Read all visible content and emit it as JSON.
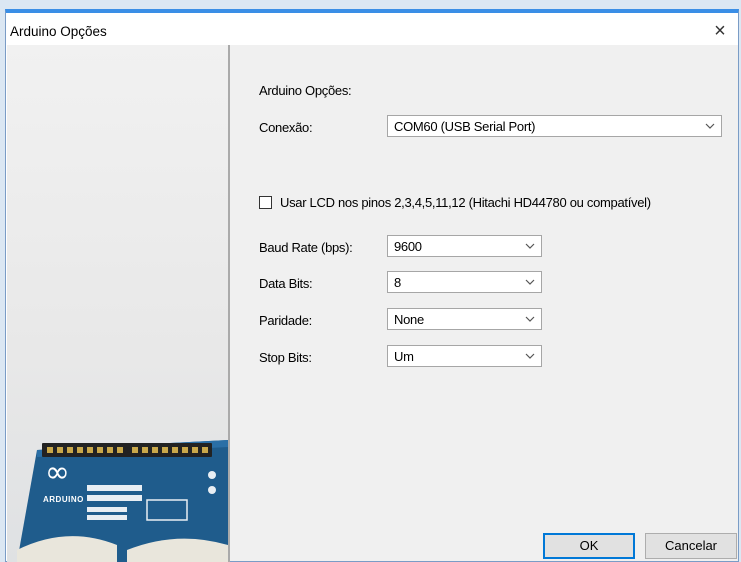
{
  "window": {
    "title": "Arduino Opções",
    "close_glyph": "×"
  },
  "board_image": {
    "icon": "arduino-board-image",
    "brand_text": "ARDUINO",
    "logo_glyph": "∞"
  },
  "form": {
    "heading": "Arduino Opções:",
    "connection": {
      "label": "Conexão:",
      "value": "COM60 (USB Serial Port)"
    },
    "lcd_checkbox": {
      "label": "Usar LCD nos pinos 2,3,4,5,11,12  (Hitachi HD44780 ou compatível)",
      "checked": false
    },
    "baud_rate": {
      "label": "Baud Rate (bps):",
      "value": "9600"
    },
    "data_bits": {
      "label": "Data Bits:",
      "value": "8"
    },
    "parity": {
      "label": "Paridade:",
      "value": "None"
    },
    "stop_bits": {
      "label": "Stop Bits:",
      "value": "Um"
    }
  },
  "buttons": {
    "ok": "OK",
    "cancel": "Cancelar"
  }
}
